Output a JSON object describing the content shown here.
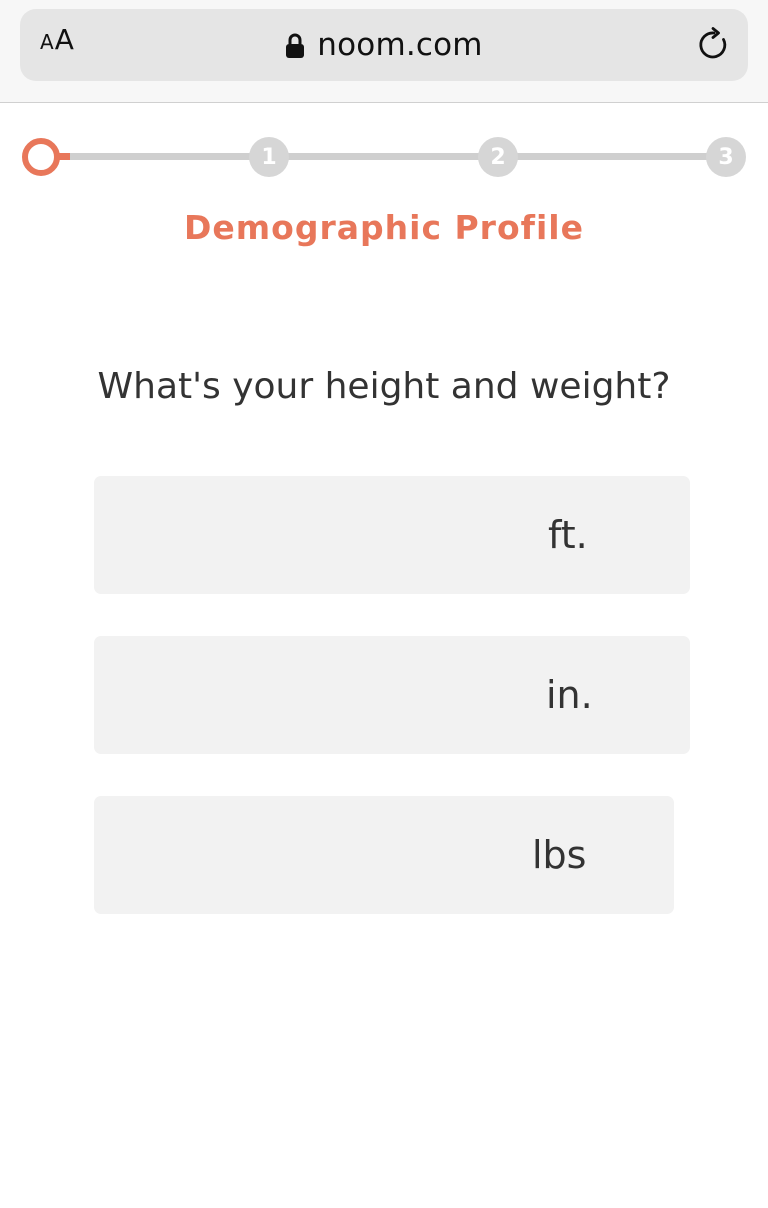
{
  "browser": {
    "text_size_small": "A",
    "text_size_large": "A",
    "url": "noom.com",
    "icons": {
      "lock": "lock-icon",
      "reload": "reload-icon"
    }
  },
  "progress": {
    "current_step": 0,
    "steps": [
      "1",
      "2",
      "3"
    ],
    "accent_color": "#e8775a",
    "inactive_color": "#d6d6d6"
  },
  "page": {
    "section_title": "Demographic Profile",
    "question": "What's your height and weight?"
  },
  "fields": {
    "feet": {
      "value": "",
      "unit": "ft."
    },
    "inches": {
      "value": "",
      "unit": "in."
    },
    "pounds": {
      "value": "",
      "unit": "lbs"
    }
  }
}
